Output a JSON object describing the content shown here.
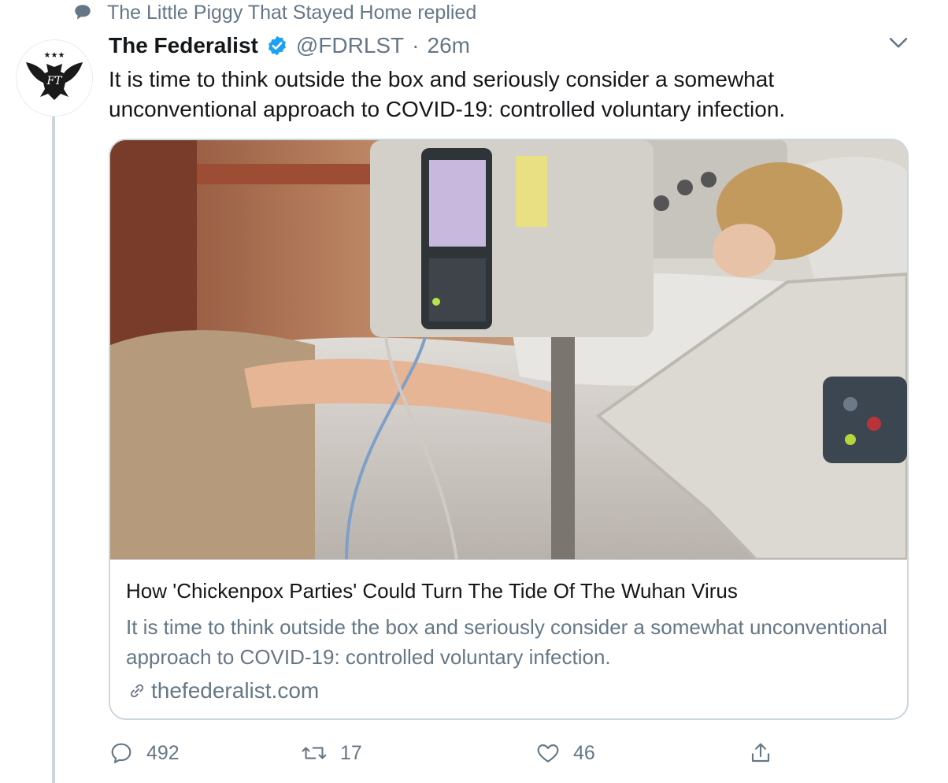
{
  "context": {
    "text": "The Little Piggy That Stayed Home replied",
    "icon": "speech-bubble-icon"
  },
  "tweet": {
    "display_name": "The Federalist",
    "verified": true,
    "handle": "@FDRLST",
    "separator": "·",
    "time": "26m",
    "text": "It is time to think outside the box and seriously consider a somewhat unconventional approach to COVID-19: controlled voluntary infection."
  },
  "card": {
    "image_subject": "Patient resting in a hospital bed beside an IV infusion pump",
    "title": "How 'Chickenpox Parties' Could Turn The Tide Of The Wuhan Virus",
    "description": "It is time to think outside the box and seriously consider a somewhat unconventional approach to COVID-19: controlled voluntary infection.",
    "domain": "thefederalist.com"
  },
  "actions": {
    "reply_count": "492",
    "retweet_count": "17",
    "like_count": "46"
  },
  "colors": {
    "primary_text": "#14171a",
    "secondary_text": "#657786",
    "verified_blue": "#1da1f2",
    "border": "#ccd6dd"
  }
}
